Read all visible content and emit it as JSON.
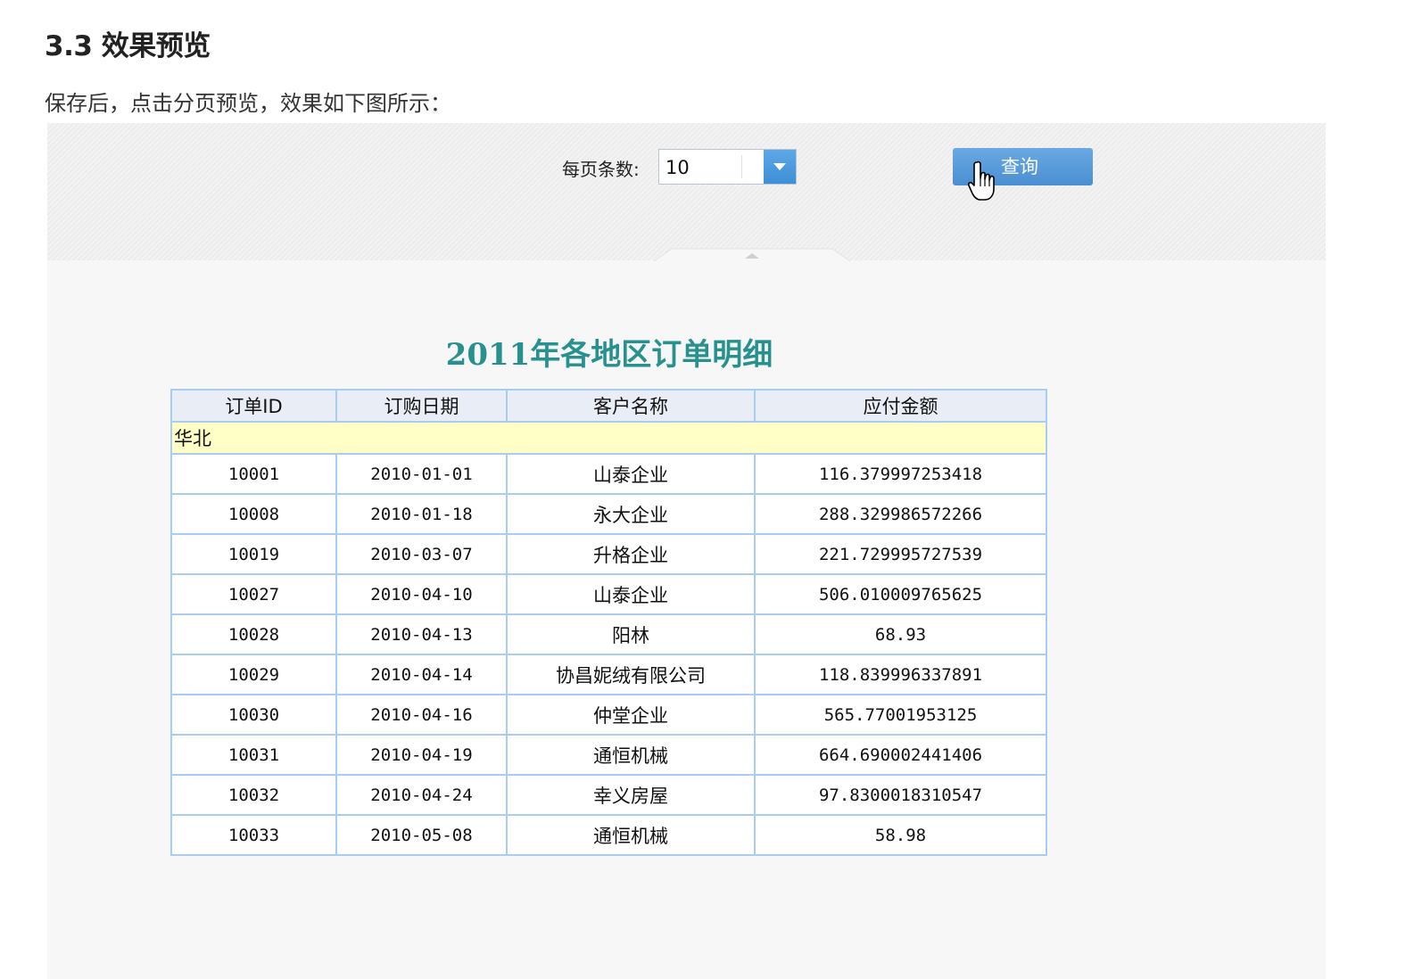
{
  "document": {
    "heading": "3.3 效果预览",
    "paragraph": "保存后，点击分页预览，效果如下图所示："
  },
  "param_panel": {
    "page_size_label": "每页条数:",
    "page_size_value": "10",
    "query_button_label": "查询"
  },
  "report": {
    "title": "2011年各地区订单明细",
    "columns": [
      "订单ID",
      "订购日期",
      "客户名称",
      "应付金额"
    ],
    "group": "华北",
    "rows": [
      {
        "id": "10001",
        "date": "2010-01-01",
        "customer": "山泰企业",
        "amount": "116.379997253418"
      },
      {
        "id": "10008",
        "date": "2010-01-18",
        "customer": "永大企业",
        "amount": "288.329986572266"
      },
      {
        "id": "10019",
        "date": "2010-03-07",
        "customer": "升格企业",
        "amount": "221.729995727539"
      },
      {
        "id": "10027",
        "date": "2010-04-10",
        "customer": "山泰企业",
        "amount": "506.010009765625"
      },
      {
        "id": "10028",
        "date": "2010-04-13",
        "customer": "阳林",
        "amount": "68.93"
      },
      {
        "id": "10029",
        "date": "2010-04-14",
        "customer": "协昌妮绒有限公司",
        "amount": "118.839996337891"
      },
      {
        "id": "10030",
        "date": "2010-04-16",
        "customer": "仲堂企业",
        "amount": "565.77001953125"
      },
      {
        "id": "10031",
        "date": "2010-04-19",
        "customer": "通恒机械",
        "amount": "664.690002441406"
      },
      {
        "id": "10032",
        "date": "2010-04-24",
        "customer": "幸义房屋",
        "amount": "97.8300018310547"
      },
      {
        "id": "10033",
        "date": "2010-05-08",
        "customer": "通恒机械",
        "amount": "58.98"
      }
    ]
  },
  "colors": {
    "title": "#26918f",
    "header_bg": "#e9edf5",
    "group_bg": "#ffffc6",
    "border": "#a9cdf0",
    "button": "#4a8fd2"
  }
}
